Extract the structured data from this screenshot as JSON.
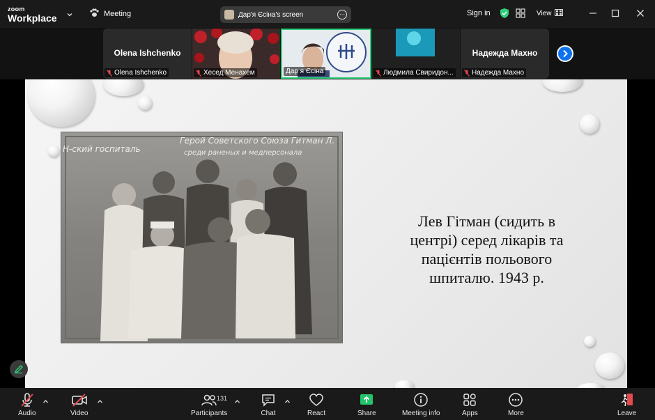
{
  "app": {
    "brand_top": "zoom",
    "brand_bottom": "Workplace"
  },
  "topbar": {
    "meeting_label": "Meeting",
    "share_label": "Дар'я Єсіна's screen",
    "sign_in": "Sign in",
    "view_label": "View"
  },
  "gallery": {
    "tiles": [
      {
        "name": "Olena Ishchenko",
        "label": "Olena Ishchenko"
      },
      {
        "name": "",
        "label": "Хесед Менахем"
      },
      {
        "name": "",
        "label": "Дар я Єсіна"
      },
      {
        "name": "",
        "label": "Людмила Свиридон..."
      },
      {
        "name": "Надежда Махно",
        "label": "Надежда Махно"
      }
    ]
  },
  "slide": {
    "photo_caption_1": "Н-ский госпиталь",
    "photo_caption_2": "Герой Советского Союза Гитман Л.",
    "photo_caption_3": "среди раненых и медперсонала",
    "caption": "Лев Гітман (сидить в центрі) серед лікарів та пацієнтів польового шпиталю. 1943 р."
  },
  "toolbar": {
    "audio": "Audio",
    "video": "Video",
    "participants": "Participants",
    "participants_count": "131",
    "chat": "Chat",
    "react": "React",
    "share": "Share",
    "meeting_info": "Meeting info",
    "apps": "Apps",
    "more": "More",
    "leave": "Leave"
  },
  "colors": {
    "accent_green": "#2fd07c",
    "share_green": "#23c36b",
    "mute_red": "#e5484d",
    "next_blue": "#0e72ed"
  }
}
